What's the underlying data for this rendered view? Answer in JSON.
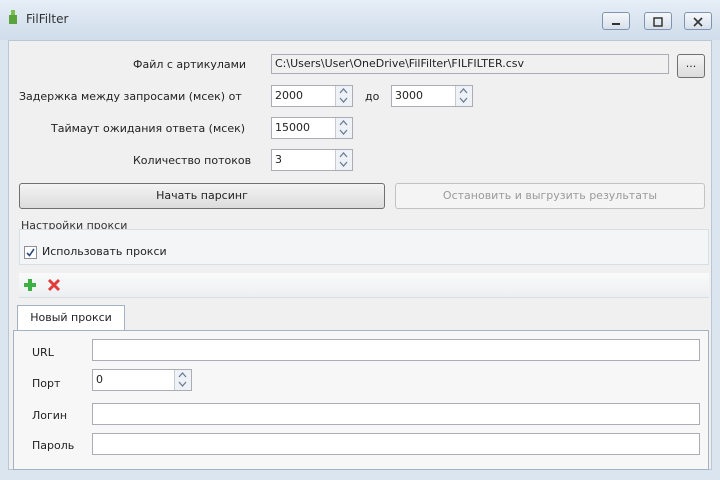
{
  "window": {
    "title": "FilFilter",
    "controls": {
      "minimize": "minimize",
      "maximize": "maximize",
      "close": "close"
    }
  },
  "form": {
    "file_label": "Файл с артикулами",
    "file_path": "C:\\Users\\User\\OneDrive\\FilFilter\\FILFILTER.csv",
    "browse_label": "...",
    "delay_label": "Задержка между запросами (мсек) от",
    "delay_from": "2000",
    "delay_to_label": "до",
    "delay_to": "3000",
    "timeout_label": "Таймаут ожидания ответа (мсек)",
    "timeout_value": "15000",
    "threads_label": "Количество потоков",
    "threads_value": "3"
  },
  "buttons": {
    "start": "Начать парсинг",
    "stop": "Остановить и выгрузить результаты"
  },
  "proxy": {
    "group_title": "Настройки прокси",
    "use_proxy_label": "Использовать прокси",
    "use_proxy_checked": true,
    "tab_label": "Новый прокси",
    "url_label": "URL",
    "url_value": "",
    "port_label": "Порт",
    "port_value": "0",
    "login_label": "Логин",
    "login_value": "",
    "password_label": "Пароль",
    "password_value": ""
  },
  "colors": {
    "add_icon": "#3cb043",
    "remove_icon": "#e23b3b",
    "titlebar": "#d9e4f0"
  }
}
